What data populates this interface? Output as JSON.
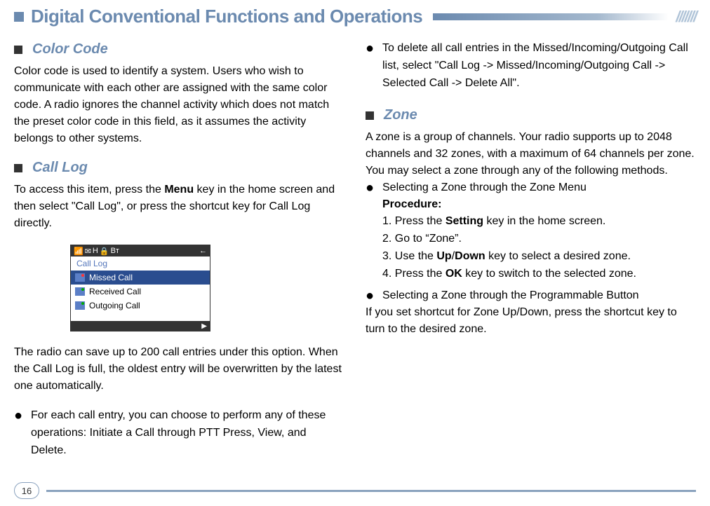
{
  "header": {
    "title": "Digital Conventional Functions and Operations",
    "hash": "///////"
  },
  "left": {
    "colorCode": {
      "title": "Color Code",
      "text": "Color code is used to identify a system. Users who wish to communicate with each other are assigned with the same color code.  A radio ignores the channel activity which does not match the preset color code in this field, as it assumes the activity belongs to other systems."
    },
    "callLog": {
      "title": "Call Log",
      "intro1": "To access this item, press the ",
      "menuWord": "Menu",
      "intro2": " key in the home screen and then select \"Call Log\", or press the shortcut key for Call Log directly.",
      "screen": {
        "bt": "Bт",
        "title": "Call Log",
        "items": [
          "Missed Call",
          "Received Call",
          "Outgoing Call"
        ]
      },
      "para": "The radio can save up to 200 call entries under this option. When the Call Log is full, the oldest entry will be overwritten by the latest one automatically.",
      "bullet": "For each call entry, you can choose to perform any of these operations: Initiate a Call through PTT Press, View, and Delete."
    }
  },
  "right": {
    "deleteBullet": "To delete all call entries in the Missed/Incoming/Outgoing Call list, select \"Call Log -> Missed/Incoming/Outgoing Call  -> Selected Call ->  Delete All\".",
    "zone": {
      "title": "Zone",
      "p1": "A zone is a group of channels. Your radio supports up to 2048 channels and 32 zones, with a maximum of 64 channels per zone.",
      "p2": "You may select a zone through any of the following methods.",
      "b1": "Selecting a Zone through the Zone Menu",
      "procLabel": "Procedure:",
      "s1a": "1.  Press the ",
      "s1b": "Setting",
      "s1c": " key in the home screen.",
      "s2": "2.  Go to “Zone”.",
      "s3a": "3.  Use the ",
      "s3b": "Up",
      "s3c": "/",
      "s3d": "Down",
      "s3e": " key to select a desired zone.",
      "s4a": "4.  Press the ",
      "s4b": "OK",
      "s4c": " key to switch to the selected zone.",
      "b2": "Selecting a Zone through the Programmable Button",
      "p3": "If you set shortcut for Zone Up/Down, press the shortcut key to turn to the desired zone."
    }
  },
  "pageNumber": "16"
}
